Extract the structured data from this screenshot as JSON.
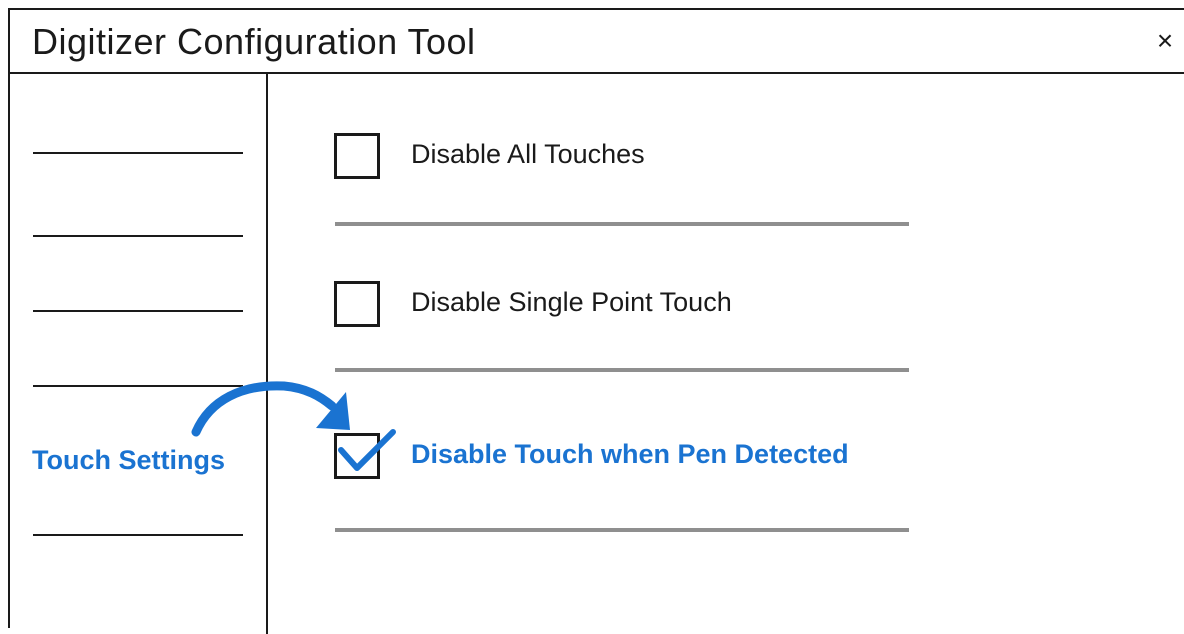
{
  "window": {
    "title": "Digitizer Configuration Tool",
    "close_symbol": "×"
  },
  "sidebar": {
    "active_item_label": "Touch Settings"
  },
  "options": [
    {
      "label": "Disable All  Touches",
      "checked": false
    },
    {
      "label": "Disable Single Point Touch",
      "checked": false
    },
    {
      "label": "Disable Touch when Pen Detected",
      "checked": true
    }
  ],
  "colors": {
    "accent": "#1a73d1",
    "text": "#1a1a1a",
    "divider": "#8f8f8f"
  },
  "icons": {
    "close": "close-icon",
    "check": "checkmark-icon",
    "pointer": "curved-arrow-icon"
  }
}
